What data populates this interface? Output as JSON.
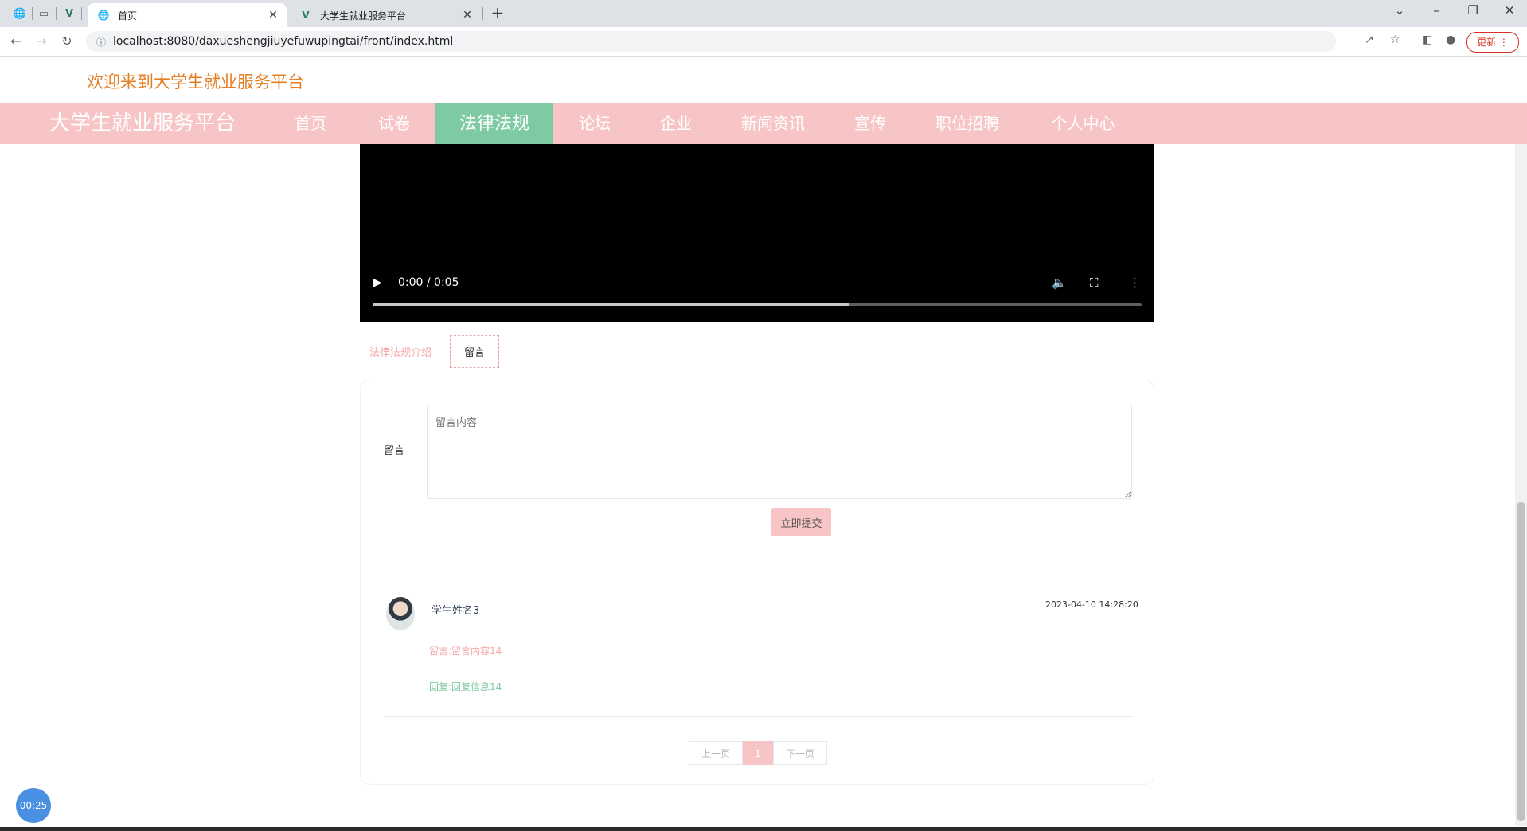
{
  "browser": {
    "tabs": [
      {
        "title": "首页",
        "active": true
      },
      {
        "title": "大学生就业服务平台",
        "active": false
      }
    ],
    "new_tab": "+",
    "url": "localhost:8080/daxueshengjiuyefuwupingtai/front/index.html",
    "update_label": "更新"
  },
  "page": {
    "welcome": "欢迎来到大学生就业服务平台",
    "brand": "大学生就业服务平台",
    "nav": [
      "首页",
      "试卷",
      "法律法规",
      "论坛",
      "企业",
      "新闻资讯",
      "宣传",
      "职位招聘",
      "个人中心"
    ],
    "nav_active_index": 2
  },
  "video": {
    "time": "0:00 / 0:05",
    "buffered_fraction": 0.62
  },
  "subtabs": [
    "法律法规介绍",
    "留言"
  ],
  "comment_form": {
    "label": "留言",
    "placeholder": "留言内容",
    "submit": "立即提交"
  },
  "comments": [
    {
      "user": "学生姓名3",
      "time": "2023-04-10 14:28:20",
      "message": "留言:留言内容14",
      "reply": "回复:回复信息14"
    }
  ],
  "pagination": {
    "prev": "上一页",
    "current": "1",
    "next": "下一页"
  },
  "recorder": {
    "timer": "00:25"
  },
  "colors": {
    "nav_bg": "#f7c5c5",
    "nav_active": "#7ecaa3",
    "welcome": "#e67e22",
    "accent_pink": "#f4a7a7",
    "accent_green": "#7ecaa3"
  }
}
